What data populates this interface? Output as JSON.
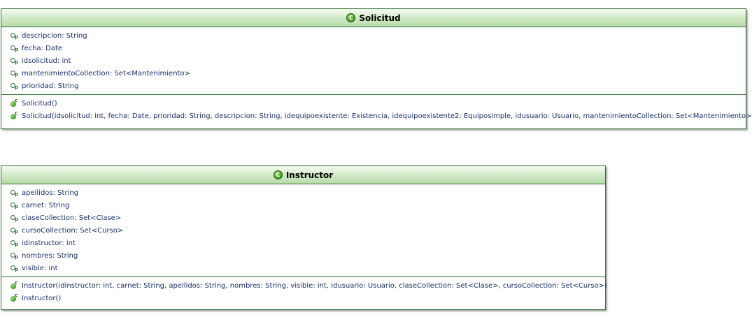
{
  "classes": {
    "solicitud": {
      "name": "Solicitud",
      "attributes": [
        {
          "text": "descripcion: String"
        },
        {
          "text": "fecha: Date"
        },
        {
          "text": "idsolicitud: int"
        },
        {
          "text": "mantenimientoCollection: Set<Mantenimiento>"
        },
        {
          "text": "prioridad: String"
        }
      ],
      "methods": [
        {
          "text": "Solicitud()"
        },
        {
          "text": "Solicitud(idsolicitud: int, fecha: Date, prioridad: String, descripcion: String, idequipoexistente: Existencia, idequipoexistente2: Equiposimple, idusuario: Usuario, mantenimientoCollection: Set<Mantenimiento>)"
        }
      ]
    },
    "instructor": {
      "name": "Instructor",
      "attributes": [
        {
          "text": "apellidos: String"
        },
        {
          "text": "carnet: String"
        },
        {
          "text": "claseCollection: Set<Clase>"
        },
        {
          "text": "cursoCollection: Set<Curso>"
        },
        {
          "text": "idinstructor: int"
        },
        {
          "text": "nombres: String"
        },
        {
          "text": "visible: int"
        }
      ],
      "methods": [
        {
          "text": "Instructor(idinstructor: int, carnet: String, apellidos: String, nombres: String, visible: int, idusuario: Usuario, claseCollection: Set<Clase>, cursoCollection: Set<Curso>)"
        },
        {
          "text": "Instructor()"
        }
      ]
    }
  },
  "icons": {
    "class_icon": "class-icon",
    "field_icon": "protected-field-icon",
    "constructor_icon": "constructor-icon",
    "field_visibility_marker": "p",
    "constructor_marker": "c",
    "class_marker": "C"
  },
  "colors": {
    "border": "#2f6f2f",
    "header_top": "#f4fbf1",
    "header_bottom": "#b8dcaa",
    "member_text": "#1b2f6b"
  }
}
